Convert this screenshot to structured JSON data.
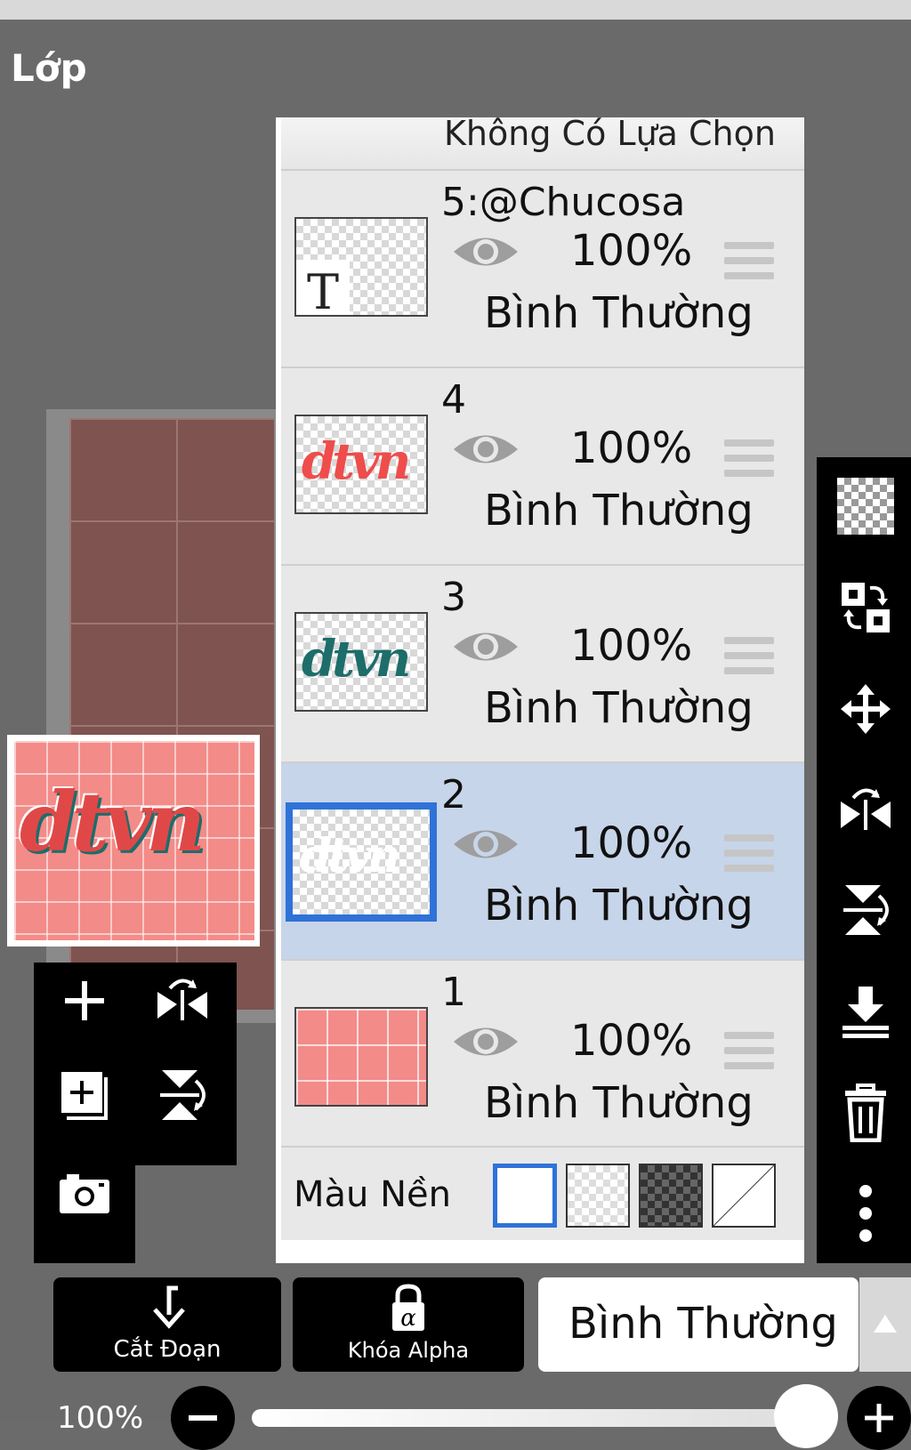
{
  "panel": {
    "title": "Lớp"
  },
  "selection": {
    "label": "Không Có Lựa Chọn"
  },
  "layers": [
    {
      "name": "5:@Chucosa",
      "opacity": "100%",
      "blend": "Bình Thường",
      "thumb": "text-icon",
      "visible": true
    },
    {
      "name": "4",
      "opacity": "100%",
      "blend": "Bình Thường",
      "thumb": "pink-lettering",
      "visible": true
    },
    {
      "name": "3",
      "opacity": "100%",
      "blend": "Bình Thường",
      "thumb": "teal-lettering",
      "visible": true
    },
    {
      "name": "2",
      "opacity": "100%",
      "blend": "Bình Thường",
      "thumb": "white-lettering",
      "visible": true,
      "selected": true
    },
    {
      "name": "1",
      "opacity": "100%",
      "blend": "Bình Thường",
      "thumb": "pink-grid",
      "visible": true
    }
  ],
  "background": {
    "label": "Màu Nền",
    "options": [
      "white",
      "transparent",
      "dark-checker",
      "none"
    ],
    "selected": "white"
  },
  "bottom": {
    "clip_label": "Cắt Đoạn",
    "alpha_label": "Khóa Alpha",
    "blend_mode": "Bình Thường",
    "opacity_label": "100%"
  },
  "colors": {
    "accent": "#2f72d8",
    "selected_row": "#c7d5ea",
    "pink": "#f38b88",
    "teal": "#1d6d6b"
  },
  "preview": {
    "word": "dtvn"
  }
}
